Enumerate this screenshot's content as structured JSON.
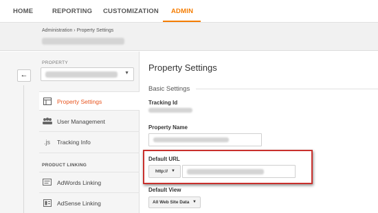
{
  "nav": {
    "tabs": [
      {
        "label": "HOME"
      },
      {
        "label": "REPORTING"
      },
      {
        "label": "CUSTOMIZATION"
      },
      {
        "label": "ADMIN"
      }
    ],
    "active_tab": "ADMIN",
    "accent_color": "#f57c00"
  },
  "header": {
    "breadcrumb": "Administration › Property Settings"
  },
  "sidebar": {
    "back_icon": "left-arrow-icon",
    "property_label": "PROPERTY",
    "items": [
      {
        "label": "Property Settings",
        "icon": "settings-panel-icon",
        "active": true
      },
      {
        "label": "User Management",
        "icon": "users-icon"
      },
      {
        "label": "Tracking Info",
        "icon": "js-icon",
        "icon_text": ".js"
      }
    ],
    "section_label": "PRODUCT LINKING",
    "linking_items": [
      {
        "label": "AdWords Linking",
        "icon": "adwords-icon"
      },
      {
        "label": "AdSense Linking",
        "icon": "adsense-icon"
      }
    ]
  },
  "main": {
    "title": "Property Settings",
    "section": "Basic Settings",
    "tracking_id_label": "Tracking Id",
    "property_name_label": "Property Name",
    "default_url_label": "Default URL",
    "protocol": "http://",
    "default_view_label": "Default View",
    "default_view_value": "All Web Site Data"
  },
  "colors": {
    "active_nav_label": "#e8541e",
    "highlight_border": "#c9302c"
  }
}
